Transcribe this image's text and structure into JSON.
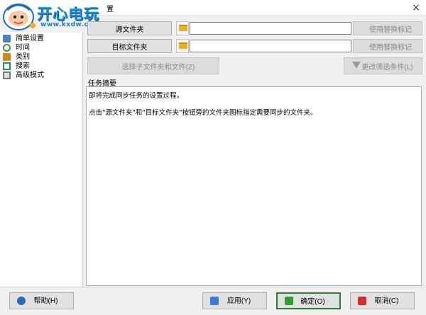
{
  "window": {
    "title": "置",
    "close_glyph": "×"
  },
  "watermark": {
    "name": "开心电玩",
    "url": "www.kxdw.com"
  },
  "nav": {
    "items": [
      {
        "label": "简单设置",
        "icon": "settings-icon",
        "color": "#4a7fc1"
      },
      {
        "label": "时间",
        "icon": "clock-icon",
        "color": "#3a9a3a"
      },
      {
        "label": "类别",
        "icon": "category-icon",
        "color": "#d08a1a"
      },
      {
        "label": "搜索",
        "icon": "search-icon",
        "color": "#2e8b57"
      },
      {
        "label": "高级模式",
        "icon": "advanced-icon",
        "color": "#7a7a7a"
      }
    ]
  },
  "source": {
    "button_label": "源文件夹",
    "value": "",
    "replace_label": "使用替换标记"
  },
  "target": {
    "button_label": "目标文件夹",
    "value": "",
    "replace_label": "使用替换标记"
  },
  "actions": {
    "select_subfolders": "选择子文件夹和文件(Z)",
    "change_filter": "更改筛选条件(L)"
  },
  "summary": {
    "heading": "任务摘要",
    "line1": "即将完成同步任务的设置过程。",
    "line2": "点击\"源文件夹\"和\"目标文件夹\"按钮旁的文件夹图标指定需要同步的文件夹。"
  },
  "footer": {
    "help": "帮助(H)",
    "apply": "应用(Y)",
    "ok": "确定(O)",
    "cancel": "取消(C)"
  },
  "colors": {
    "help_icon": "#2b6cb8",
    "apply_icon": "#3a7bd5",
    "ok_icon": "#2e9c2e",
    "cancel_icon": "#d12f2f",
    "ok_border": "#2c7d3a"
  }
}
